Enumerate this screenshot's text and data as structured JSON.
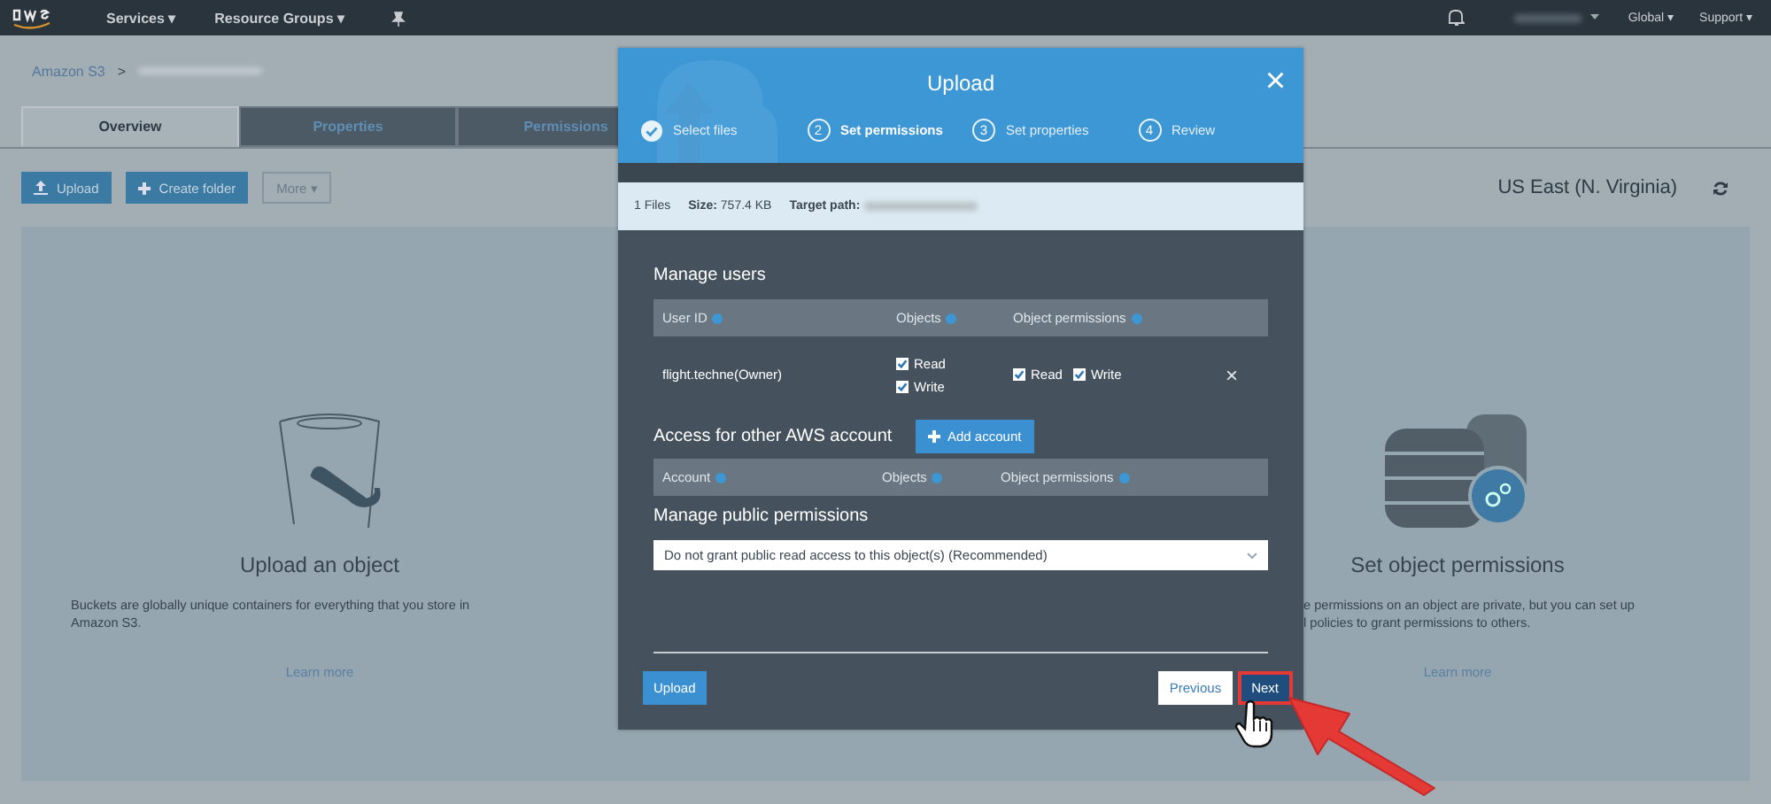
{
  "nav": {
    "menus": [
      {
        "label": "Services",
        "caret": "▾"
      },
      {
        "label": "Resource Groups",
        "caret": "▾"
      }
    ],
    "right": [
      {
        "label": "Global",
        "caret": "▾"
      },
      {
        "label": "Support",
        "caret": "▾"
      }
    ]
  },
  "breadcrumb": {
    "root": "Amazon S3",
    "separator": ">"
  },
  "tabs": [
    {
      "label": "Overview",
      "selected": true
    },
    {
      "label": "Properties",
      "selected": false
    },
    {
      "label": "Permissions",
      "selected": false
    }
  ],
  "toolbar": {
    "buttons": [
      {
        "label": "Upload",
        "kind": "primary"
      },
      {
        "label": "Create folder",
        "kind": "primary"
      },
      {
        "label": "More",
        "kind": "dropdown",
        "caret": "▾"
      }
    ],
    "region": "US East (N. Virginia)"
  },
  "cards": [
    {
      "title": "Upload an object",
      "lines": [
        "Buckets are globally unique containers for everything that you store in",
        "Amazon S3."
      ],
      "link": "Learn more"
    },
    {
      "title": "Set object permissions",
      "lines": [
        "e permissions on an object are private, but you can set up",
        "l policies to grant permissions to others."
      ],
      "link": "Learn more"
    }
  ],
  "dialog": {
    "title": "Upload",
    "close": "×",
    "steps": [
      {
        "label": "Select files",
        "done": true,
        "selected": false
      },
      {
        "number": "2",
        "label": "Set permissions",
        "done": false,
        "selected": true
      },
      {
        "number": "3",
        "label": "Set properties",
        "done": false,
        "selected": false
      },
      {
        "number": "4",
        "label": "Review",
        "done": false,
        "selected": false
      }
    ],
    "info": {
      "files": "1 Files",
      "size": "**Size:** 757.4 KB",
      "target": "Target path:"
    },
    "users": {
      "heading": "Manage users",
      "columns": [
        "User ID",
        "Objects",
        "Object permissions"
      ],
      "rows": [
        {
          "user": "flight.techne(Owner)",
          "objects": [
            {
              "label": "Read",
              "checked": true
            },
            {
              "label": "Write",
              "checked": true
            }
          ],
          "permissions": [
            {
              "label": "Read",
              "checked": true
            },
            {
              "label": "Write",
              "checked": true
            }
          ],
          "remove": "×"
        }
      ]
    },
    "accounts": {
      "heading": "Access for other AWS account",
      "add": "Add account",
      "columns": [
        "Account",
        "Objects",
        "Object permissions"
      ]
    },
    "public": {
      "heading": "Manage public permissions",
      "value": "Do not grant public read access to this object(s) (Recommended)"
    },
    "footer": {
      "upload": "Upload",
      "previous": "Previous",
      "next": "Next",
      "next_highlighted": true
    }
  }
}
